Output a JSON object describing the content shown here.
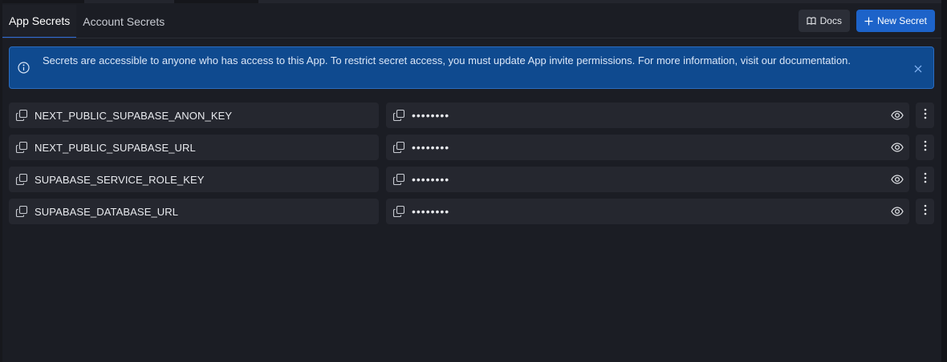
{
  "tabs": [
    {
      "label": "App Secrets",
      "active": true
    },
    {
      "label": "Account Secrets",
      "active": false
    }
  ],
  "actions": {
    "docs_label": "Docs",
    "docs_icon": "book-icon",
    "new_label": "New Secret",
    "new_icon": "plus-icon"
  },
  "banner": {
    "message": "Secrets are accessible to anyone who has access to this App. To restrict secret access, you must update App invite permissions. For more information, visit our documentation.",
    "info_icon": "info-icon",
    "close_icon": "close-icon"
  },
  "secrets": [
    {
      "name": "NEXT_PUBLIC_SUPABASE_ANON_KEY",
      "value": "••••••••"
    },
    {
      "name": "NEXT_PUBLIC_SUPABASE_URL",
      "value": "••••••••"
    },
    {
      "name": "SUPABASE_SERVICE_ROLE_KEY",
      "value": "••••••••"
    },
    {
      "name": "SUPABASE_DATABASE_URL",
      "value": "••••••••"
    }
  ],
  "colors": {
    "accent": "#1d63c9",
    "banner_bg": "#0f4a8f",
    "background": "#1b1d24",
    "row_bg": "#25272f"
  }
}
